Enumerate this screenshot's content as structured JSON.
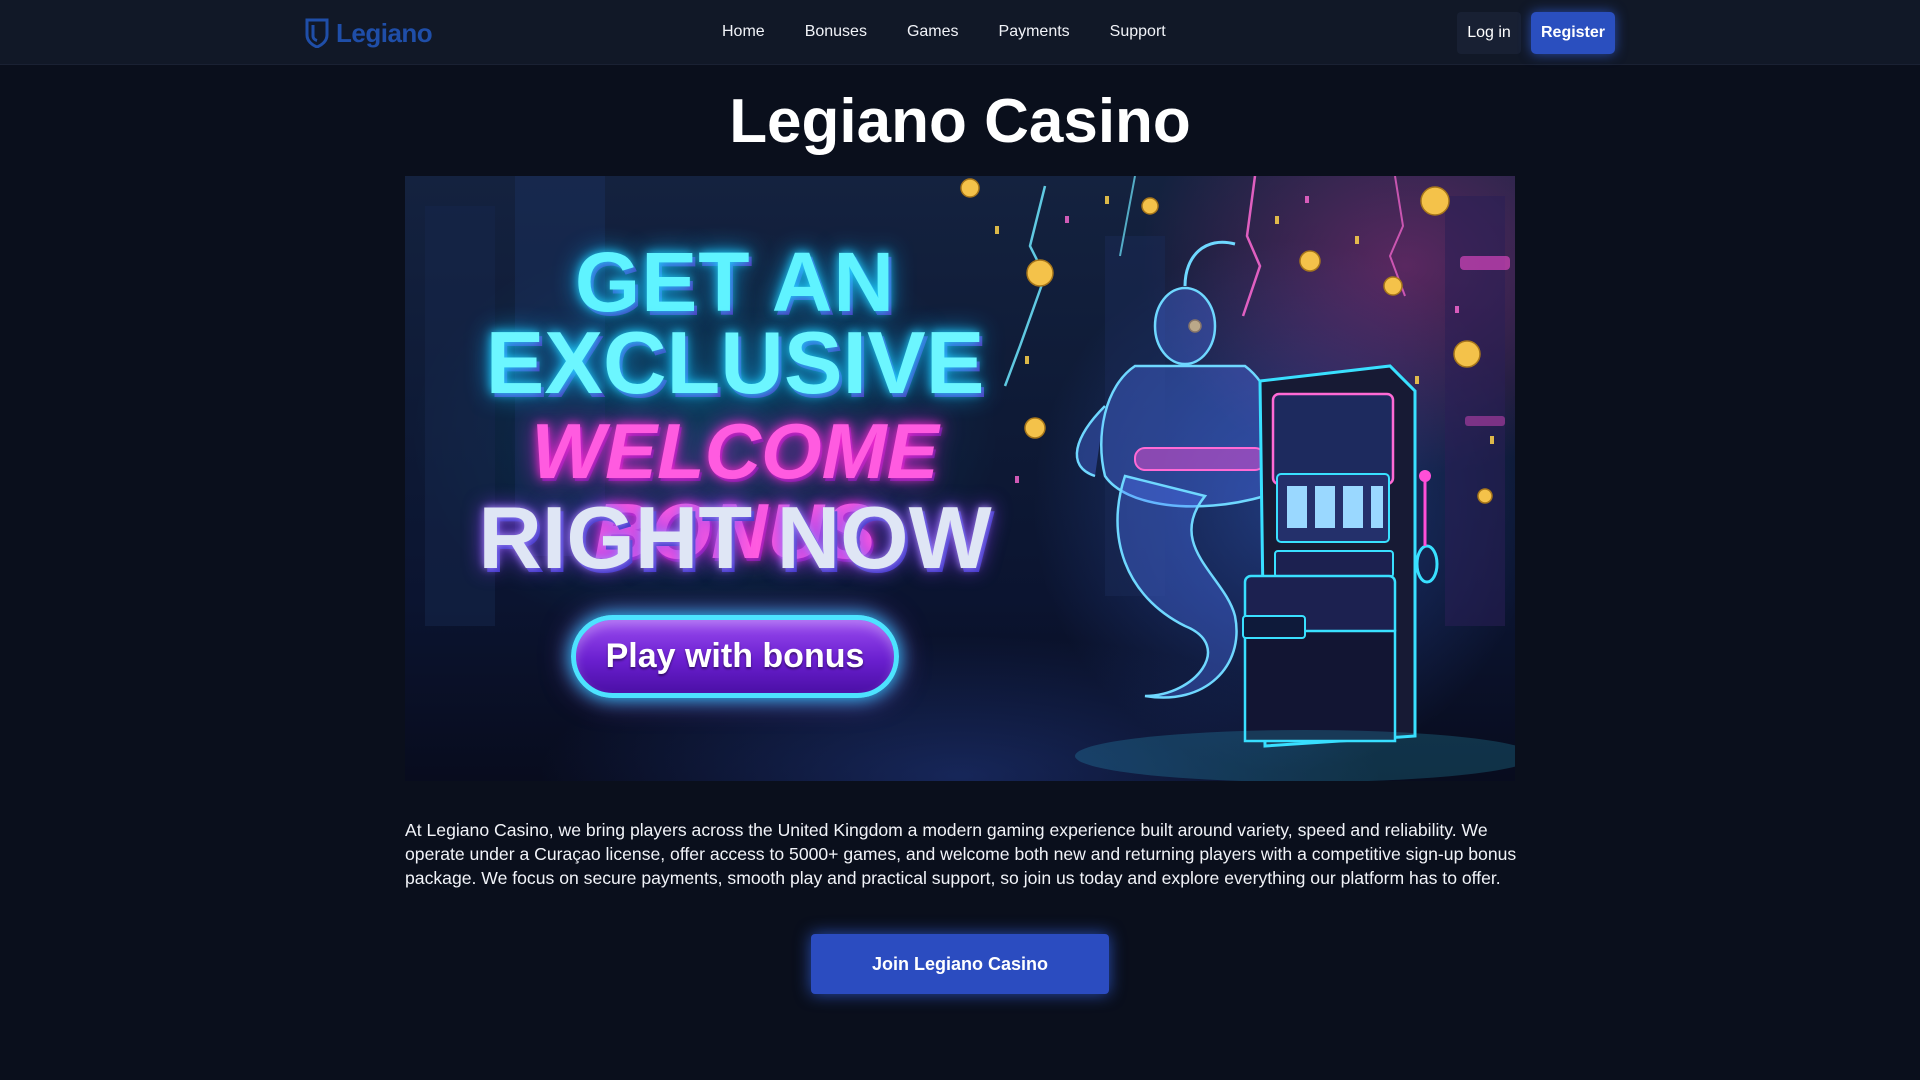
{
  "header": {
    "logo_text": "Legiano",
    "nav": [
      "Home",
      "Bonuses",
      "Games",
      "Payments",
      "Support"
    ],
    "login_label": "Log in",
    "register_label": "Register"
  },
  "main": {
    "title": "Legiano Casino",
    "hero": {
      "line1": "GET AN",
      "line2": "EXCLUSIVE",
      "line3": "WELCOME BONUS",
      "line4": "RIGHT NOW",
      "button_label": "Play with bonus"
    },
    "intro": "At Legiano Casino, we bring players across the United Kingdom a modern gaming experience built around variety, speed and reliability. We operate under a Curaçao license, offer access to 5000+ games, and welcome both new and returning players with a competitive sign-up bonus package. We focus on secure payments, smooth play and practical support, so join us today and explore everything our platform has to offer.",
    "cta_label": "Join Legiano Casino"
  },
  "colors": {
    "background": "#0a0f1c",
    "header": "#111827",
    "accent": "#2b4cc0",
    "logo": "#1f4ea8"
  },
  "icons": {
    "logo": "shield-logo-icon"
  }
}
